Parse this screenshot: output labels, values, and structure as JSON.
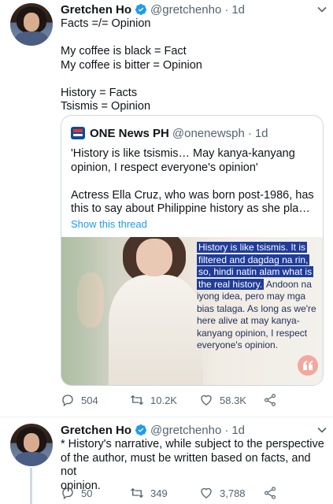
{
  "tweet1": {
    "author": {
      "name": "Gretchen Ho",
      "handle": "@gretchenho",
      "dot": "·",
      "time": "1d"
    },
    "lines": [
      "Facts =/= Opinion",
      "",
      "My coffee is black = Fact",
      "My coffee is bitter = Opinion",
      "",
      "History = Facts",
      "Tsismis = Opinion"
    ],
    "quote": {
      "author": {
        "name": "ONE News PH",
        "handle": "@onenewsph",
        "dot": "·",
        "time": "1d"
      },
      "lines": [
        "'History is like tsismis… May kanya-kanyang",
        "opinion, I respect everyone's opinion'",
        "",
        "Actress Ella Cruz, who was born post-1986, has",
        "this to say about Philippine history as she plays t…"
      ],
      "show_thread": "Show this thread",
      "media_caption": {
        "highlighted": "History is like tsismis. It is filtered and dagdag na rin, so, hindi natin alam what is the real history.",
        "plain": " Andoon na iyong idea, pero may mga bias talaga. As long as we're here alive at may kanya-kanyang opinion, I respect everyone's opinion."
      }
    },
    "actions": {
      "replies": "504",
      "retweets": "10.2K",
      "likes": "58.3K"
    }
  },
  "tweet2": {
    "author": {
      "name": "Gretchen Ho",
      "handle": "@gretchenho",
      "dot": "·",
      "time": "1d"
    },
    "lines": [
      "* History's narrative, while subject to the perspective",
      "of the author, must be written based on facts, and not",
      "opinion."
    ],
    "actions": {
      "replies": "50",
      "retweets": "349",
      "likes": "3,788"
    }
  },
  "colors": {
    "accent": "#1d9bf0",
    "muted": "#536471",
    "border": "#cfd9de",
    "caption_highlight": "#1f3c9a"
  }
}
